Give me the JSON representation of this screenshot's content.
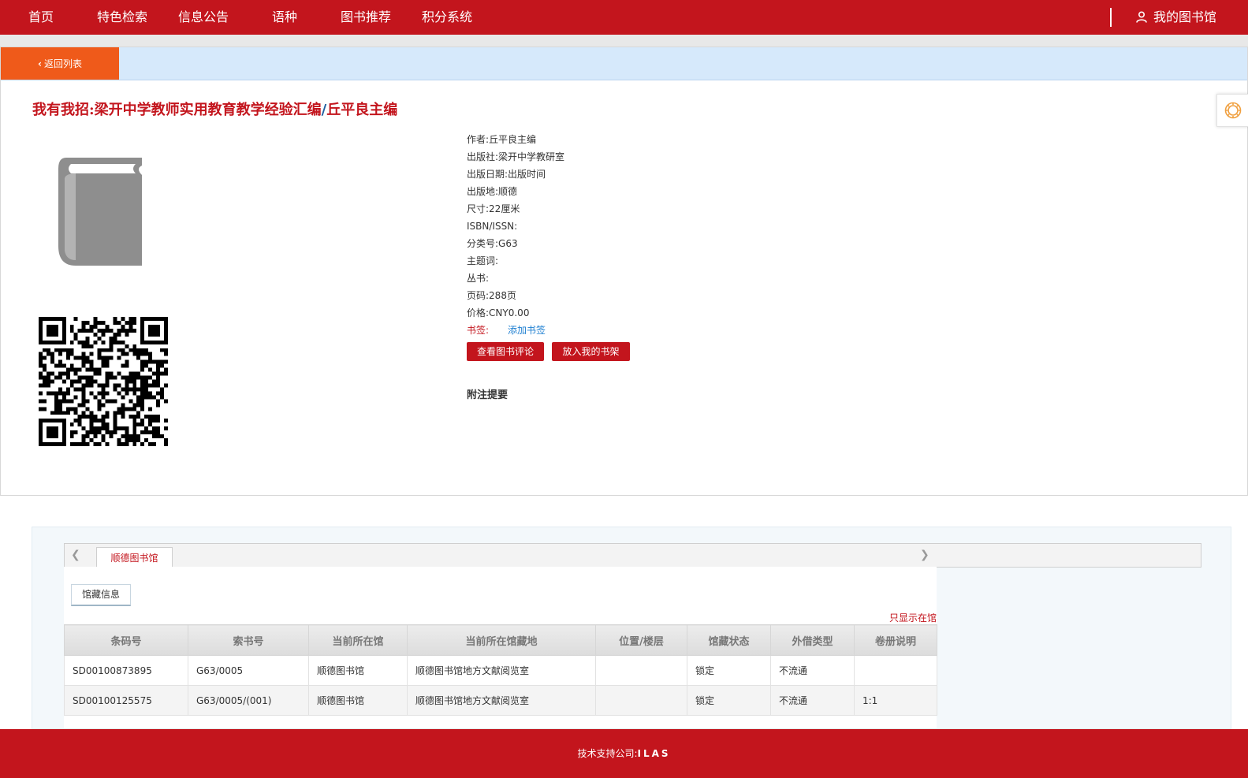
{
  "nav": {
    "items": [
      {
        "label": "首页"
      },
      {
        "label": "特色检索"
      },
      {
        "label": "信息公告"
      },
      {
        "label": "语种"
      },
      {
        "label": "图书推荐"
      },
      {
        "label": "积分系统"
      }
    ],
    "my_library": "我的图书馆",
    "my_library_icon": "user-icon"
  },
  "back": {
    "label": "返回列表",
    "icon": "chevron-left-icon"
  },
  "book": {
    "title": "我有我招:梁开中学教师实用教育教学经验汇编",
    "separator": "/",
    "responsibility": "丘平良主编",
    "fields": [
      {
        "key": "作者:",
        "value": "丘平良主编"
      },
      {
        "key": "出版社:",
        "value": "梁开中学教研室"
      },
      {
        "key": "出版日期:",
        "value": "出版时间"
      },
      {
        "key": "出版地:",
        "value": "顺德"
      },
      {
        "key": "尺寸:",
        "value": "22厘米"
      },
      {
        "key": "ISBN/ISSN:",
        "value": ""
      },
      {
        "key": "分类号:",
        "value": "G63"
      },
      {
        "key": "主题词:",
        "value": ""
      },
      {
        "key": "丛书:",
        "value": ""
      },
      {
        "key": "页码:",
        "value": "288页"
      },
      {
        "key": "价格:",
        "value": "CNY0.00"
      }
    ],
    "bookmark_label": "书签:",
    "add_bookmark": "添加书签",
    "buttons": {
      "reviews": "查看图书评论",
      "shelf": "放入我的书架"
    },
    "note_heading": "附注提要",
    "cover_icon": "book-icon",
    "qr_icon": "qr-code-icon",
    "settings_icon": "gear-icon"
  },
  "holdings": {
    "library_tab": "顺德图书馆",
    "sub_tab": "馆藏信息",
    "only_in_library": "只显示在馆",
    "columns": [
      "条码号",
      "索书号",
      "当前所在馆",
      "当前所在馆藏地",
      "位置/楼层",
      "馆藏状态",
      "外借类型",
      "卷册说明"
    ],
    "rows": [
      [
        "SD00100873895",
        "G63/0005",
        "顺德图书馆",
        "顺德图书馆地方文献阅览室",
        "",
        "锁定",
        "不流通",
        ""
      ],
      [
        "SD00100125575",
        "G63/0005/(001)",
        "顺德图书馆",
        "顺德图书馆地方文献阅览室",
        "",
        "锁定",
        "不流通",
        "1:1"
      ]
    ]
  },
  "footer": {
    "label": "技术支持公司:",
    "company": "ILAS"
  },
  "colors": {
    "brand_red": "#c3151d",
    "back_orange": "#ef5a1a",
    "link_blue": "#1e7fd1",
    "light_blue_bar": "#d6e9fb"
  }
}
